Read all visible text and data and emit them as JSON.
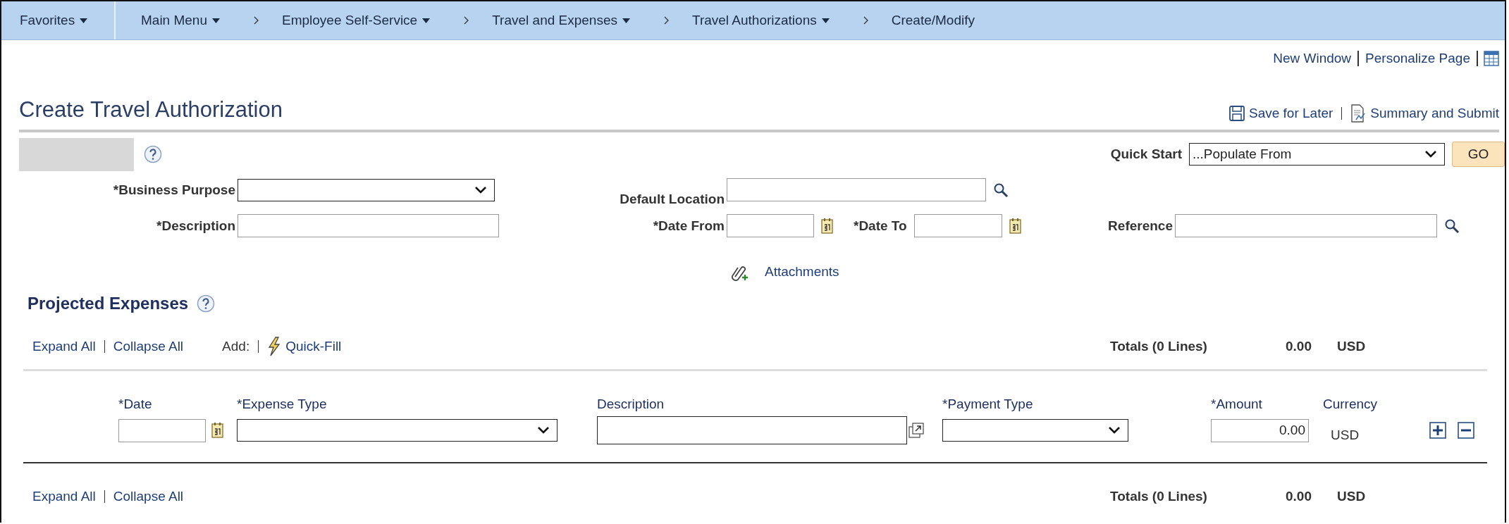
{
  "nav": {
    "items": [
      {
        "label": "Favorites",
        "kind": "favorites",
        "has_menu": true
      },
      {
        "label": "Main Menu",
        "kind": "crumb",
        "has_menu": true
      },
      {
        "label": "Employee Self-Service",
        "kind": "crumb",
        "has_menu": true
      },
      {
        "label": "Travel and Expenses",
        "kind": "crumb",
        "has_menu": true
      },
      {
        "label": "Travel Authorizations",
        "kind": "crumb",
        "has_menu": true
      },
      {
        "label": "Create/Modify",
        "kind": "crumb",
        "has_menu": false
      }
    ]
  },
  "page_links": [
    "New Window",
    "Personalize Page"
  ],
  "title": "Create Travel Authorization",
  "actions": [
    {
      "label": "Save for Later"
    },
    {
      "label": "Summary and Submit"
    }
  ],
  "form": {
    "quick_start": {
      "label": "Quick Start",
      "value": "...Populate From",
      "button": "GO"
    },
    "business_purpose": {
      "label": "*Business Purpose"
    },
    "description": {
      "label": "*Description"
    },
    "default_location": {
      "label": "Default Location"
    },
    "date_from": {
      "label": "*Date From"
    },
    "date_to": {
      "label": "*Date To"
    },
    "reference": {
      "label": "Reference"
    },
    "attachments": "Attachments"
  },
  "projected_expenses": {
    "title": "Projected Expenses",
    "top_bar": {
      "expand": "Expand All",
      "collapse": "Collapse All",
      "add": "Add:",
      "quick_fill": "Quick-Fill",
      "totals_label": "Totals (0 Lines)",
      "total": "0.00",
      "currency": "USD"
    },
    "columns": [
      "*Date",
      "*Expense Type",
      "Description",
      "*Payment Type",
      "*Amount",
      "Currency"
    ],
    "rows": [
      {
        "amount": "0.00",
        "currency": "USD"
      }
    ],
    "bottom_bar": {
      "expand": "Expand All",
      "collapse": "Collapse All",
      "totals_label": "Totals (0 Lines)",
      "total": "0.00",
      "currency": "USD"
    }
  }
}
